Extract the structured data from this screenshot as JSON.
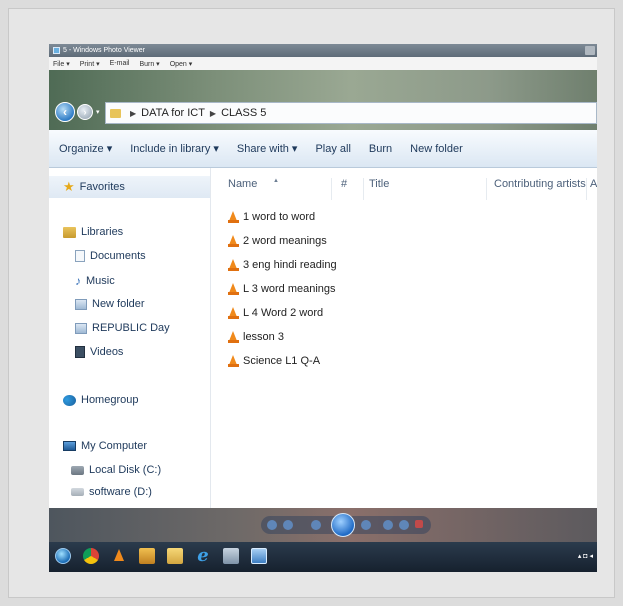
{
  "viewer": {
    "title": "5 - Windows Photo Viewer",
    "menu": [
      "File ▾",
      "Print ▾",
      "E-mail",
      "Burn ▾",
      "Open ▾"
    ]
  },
  "address": {
    "crumbs": [
      "DATA for ICT",
      "CLASS 5"
    ]
  },
  "toolbar": {
    "organize": "Organize ▾",
    "include": "Include in library ▾",
    "share": "Share with ▾",
    "play_all": "Play all",
    "burn": "Burn",
    "new_folder": "New folder"
  },
  "navpane": {
    "favorites": "Favorites",
    "libraries": "Libraries",
    "documents": "Documents",
    "music": "Music",
    "new_folder": "New folder",
    "republic": "REPUBLIC Day",
    "videos": "Videos",
    "homegroup": "Homegroup",
    "computer": "My Computer",
    "local_disk": "Local Disk (C:)",
    "software": "software (D:)"
  },
  "columns": {
    "name": "Name",
    "number": "#",
    "title": "Title",
    "artists": "Contributing artists",
    "album": "A"
  },
  "files": [
    "1 word to word",
    "2 word meanings",
    "3 eng hindi reading",
    "L 3 word meanings",
    "L 4 Word 2 word",
    "lesson 3",
    "Science L1 Q-A"
  ],
  "icons": {
    "vlc_color": "#f08a1c",
    "accent": "#1e395b"
  }
}
